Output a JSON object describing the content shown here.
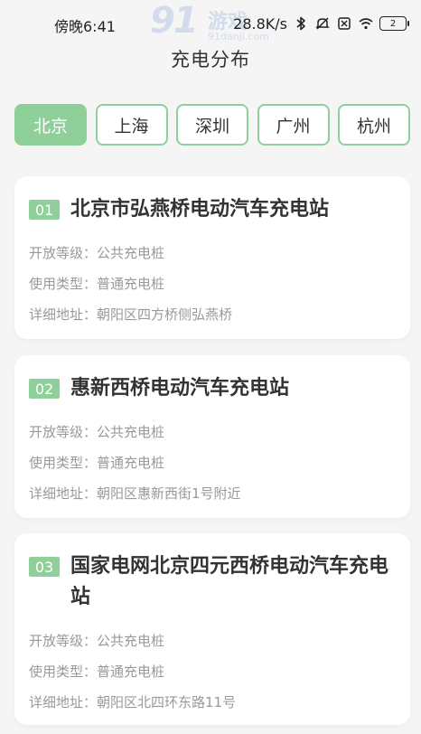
{
  "status_bar": {
    "time": "傍晚6:41",
    "speed": "28.8K/s",
    "battery": "2",
    "icons": [
      "bluetooth-icon",
      "mute-icon",
      "sim-off-icon",
      "wifi-icon",
      "battery-icon"
    ]
  },
  "watermark": {
    "logo": "91",
    "name": "游戏",
    "url": "91danji.com"
  },
  "header": {
    "title": "充电分布"
  },
  "tabs": [
    {
      "label": "北京",
      "active": true
    },
    {
      "label": "上海",
      "active": false
    },
    {
      "label": "深圳",
      "active": false
    },
    {
      "label": "广州",
      "active": false
    },
    {
      "label": "杭州",
      "active": false
    }
  ],
  "stations": [
    {
      "num": "01",
      "name": "北京市弘燕桥电动汽车充电站",
      "open_label": "开放等级：",
      "open_value": "公共充电桩",
      "type_label": "使用类型：",
      "type_value": "普通充电桩",
      "addr_label": "详细地址：",
      "addr_value": "朝阳区四方桥侧弘燕桥"
    },
    {
      "num": "02",
      "name": "惠新西桥电动汽车充电站",
      "open_label": "开放等级：",
      "open_value": "公共充电桩",
      "type_label": "使用类型：",
      "type_value": "普通充电桩",
      "addr_label": "详细地址：",
      "addr_value": "朝阳区惠新西街1号附近"
    },
    {
      "num": "03",
      "name": "国家电网北京四元西桥电动汽车充电站",
      "open_label": "开放等级：",
      "open_value": "公共充电桩",
      "type_label": "使用类型：",
      "type_value": "普通充电桩",
      "addr_label": "详细地址：",
      "addr_value": "朝阳区北四环东路11号"
    }
  ],
  "colors": {
    "accent": "#8fcf9a",
    "background": "#f5f5f5",
    "card": "#ffffff"
  }
}
